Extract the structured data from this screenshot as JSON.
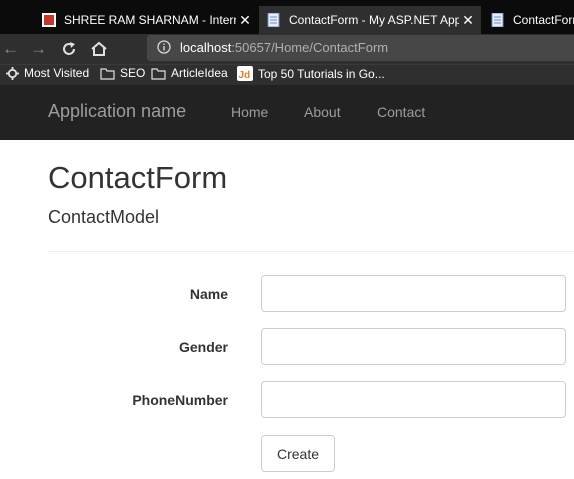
{
  "browser": {
    "tabs": [
      {
        "title": "SHREE RAM SHARNAM - Internet",
        "close": "✕",
        "active": false
      },
      {
        "title": "ContactForm - My ASP.NET Application",
        "close": "✕",
        "active": true
      },
      {
        "title": "ContactForm",
        "close": "✕",
        "active": false
      }
    ],
    "address": {
      "host": "localhost",
      "rest": ":50657/Home/ContactForm"
    },
    "bookmarks": [
      {
        "label": "Most Visited",
        "icon": "gear-icon"
      },
      {
        "label": "SEO",
        "icon": "folder-icon"
      },
      {
        "label": "ArticleIdea",
        "icon": "folder-icon"
      },
      {
        "label": "Top 50 Tutorials in Go...",
        "icon": "jd-logo-icon"
      }
    ]
  },
  "app": {
    "brand": "Application name",
    "nav": [
      "Home",
      "About",
      "Contact"
    ]
  },
  "page": {
    "title": "ContactForm",
    "subtitle": "ContactModel",
    "fields": [
      {
        "label": "Name",
        "value": ""
      },
      {
        "label": "Gender",
        "value": ""
      },
      {
        "label": "PhoneNumber",
        "value": ""
      }
    ],
    "submit_label": "Create"
  }
}
